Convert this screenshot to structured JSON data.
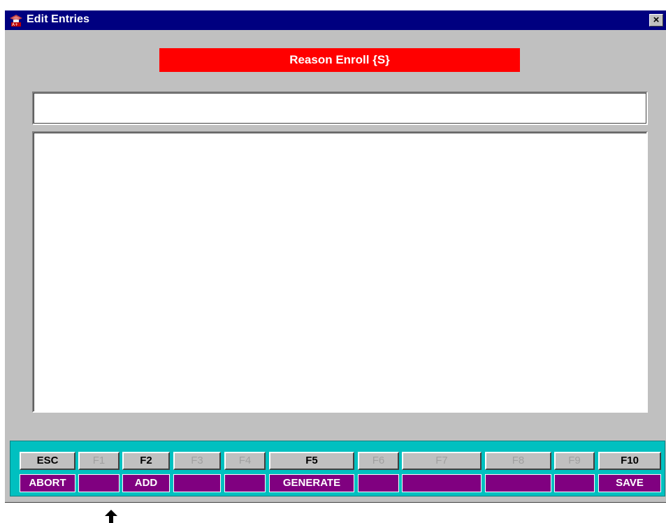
{
  "window": {
    "title": "Edit Entries",
    "close_label": "×"
  },
  "banner": {
    "text": "Reason Enroll {S}",
    "color": "#ff0000"
  },
  "entry_field": {
    "value": ""
  },
  "entries_list": {
    "items": []
  },
  "function_keys": [
    {
      "key": "ESC",
      "action": "ABORT",
      "enabled": true
    },
    {
      "key": "F1",
      "action": "",
      "enabled": false
    },
    {
      "key": "F2",
      "action": "ADD",
      "enabled": true
    },
    {
      "key": "F3",
      "action": "",
      "enabled": false
    },
    {
      "key": "F4",
      "action": "",
      "enabled": false
    },
    {
      "key": "F5",
      "action": "GENERATE",
      "enabled": true
    },
    {
      "key": "F6",
      "action": "",
      "enabled": false
    },
    {
      "key": "F7",
      "action": "",
      "enabled": false
    },
    {
      "key": "F8",
      "action": "",
      "enabled": false
    },
    {
      "key": "F9",
      "action": "",
      "enabled": false
    },
    {
      "key": "F10",
      "action": "SAVE",
      "enabled": true
    }
  ],
  "colors": {
    "titlebar": "#000080",
    "fkeybar": "#00c0c0",
    "action_bg": "#800080"
  }
}
